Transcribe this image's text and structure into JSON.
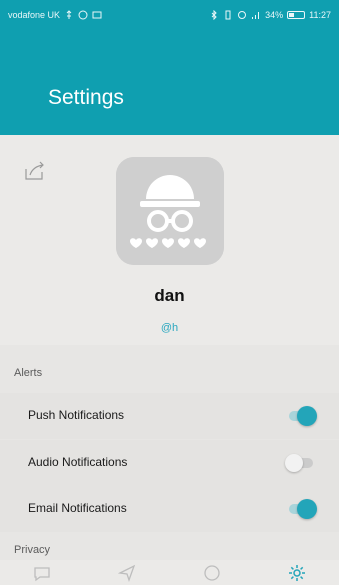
{
  "status_bar": {
    "carrier": "vodafone UK",
    "battery": "34%",
    "time": "11:27"
  },
  "header": {
    "title": "Settings"
  },
  "profile": {
    "name": "dan",
    "handle": "@h"
  },
  "sections": {
    "alerts_label": "Alerts",
    "privacy_label": "Privacy"
  },
  "alerts": [
    {
      "label": "Push Notifications",
      "enabled": true
    },
    {
      "label": "Audio Notifications",
      "enabled": false
    },
    {
      "label": "Email Notifications",
      "enabled": true
    }
  ],
  "colors": {
    "accent": "#0f9fb0",
    "toggle_on": "#23a5b9"
  },
  "nav": {
    "items": [
      "chat-icon",
      "send-icon",
      "circle-icon",
      "settings-icon"
    ]
  }
}
